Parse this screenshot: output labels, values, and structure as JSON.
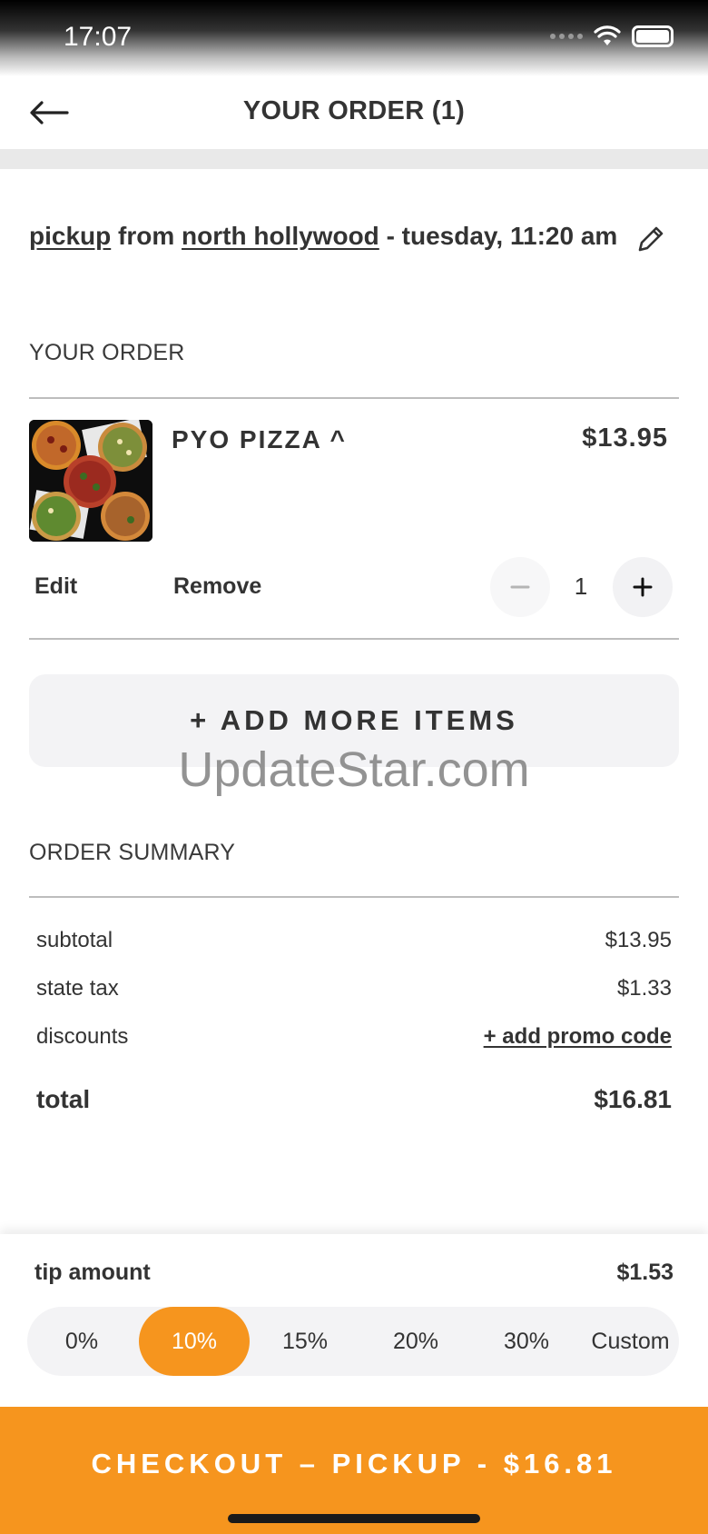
{
  "status_bar": {
    "time": "17:07"
  },
  "header": {
    "title": "YOUR ORDER (1)"
  },
  "pickup": {
    "mode": "pickup",
    "from_word": "from",
    "location": "north hollywood",
    "time": "- tuesday, 11:20 am"
  },
  "order": {
    "section_label": "YOUR ORDER",
    "items": [
      {
        "name": "PYO PIZZA ^",
        "price": "$13.95",
        "quantity": "1",
        "edit_label": "Edit",
        "remove_label": "Remove"
      }
    ],
    "add_more_label": "+ ADD MORE ITEMS"
  },
  "watermark": "UpdateStar.com",
  "summary": {
    "section_label": "ORDER SUMMARY",
    "subtotal_label": "subtotal",
    "subtotal_value": "$13.95",
    "tax_label": "state tax",
    "tax_value": "$1.33",
    "discounts_label": "discounts",
    "promo_link": "+ add promo code",
    "total_label": "total",
    "total_value": "$16.81"
  },
  "tip": {
    "label": "tip amount",
    "value": "$1.53",
    "options": [
      "0%",
      "10%",
      "15%",
      "20%",
      "30%",
      "Custom"
    ],
    "selected": "10%"
  },
  "checkout": {
    "label": "CHECKOUT – PICKUP - $16.81"
  },
  "colors": {
    "accent": "#f6951e",
    "panel": "#f3f3f5"
  }
}
